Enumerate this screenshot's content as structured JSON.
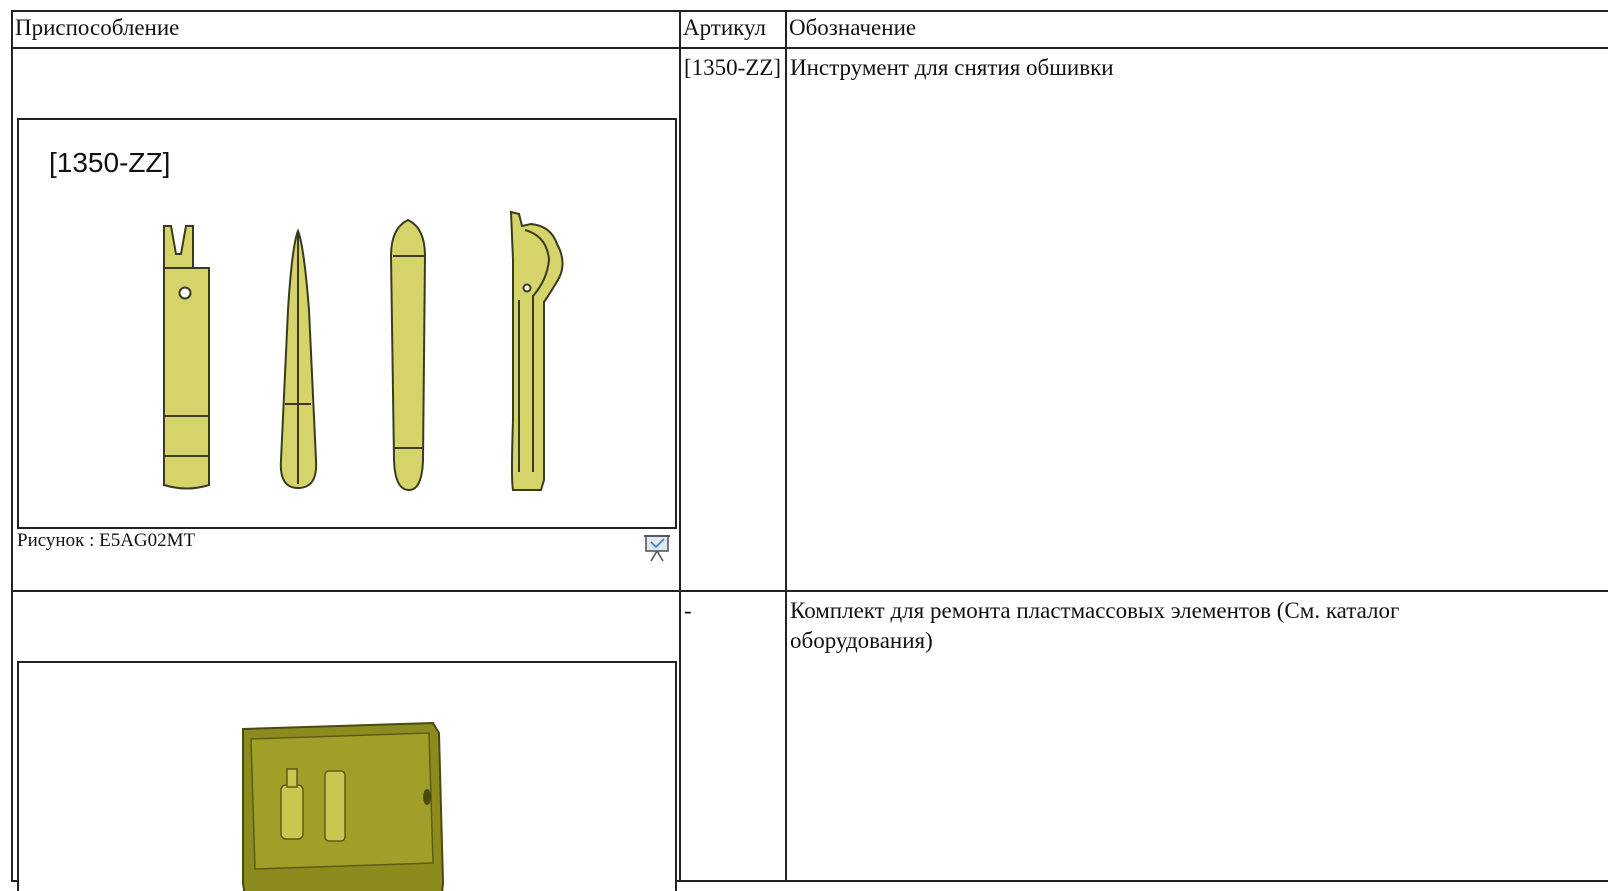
{
  "table": {
    "headers": [
      "Приспособление",
      "Артикул",
      "Обозначение"
    ],
    "rows": [
      {
        "figure_label": "[1350-ZZ]",
        "caption": "Рисунок : E5AG02MT",
        "article": "[1350-ZZ]",
        "designation": "Инструмент для снятия обшивки"
      },
      {
        "article": "-",
        "designation": "Комплект для ремонта пластмассовых элементов (См. каталог оборудования)"
      }
    ]
  },
  "colors": {
    "tool_fill": "#d4d46a",
    "tool_stroke": "#3a3a20",
    "case_fill": "#8c8c1e"
  },
  "icons": [
    "presentation-icon"
  ]
}
